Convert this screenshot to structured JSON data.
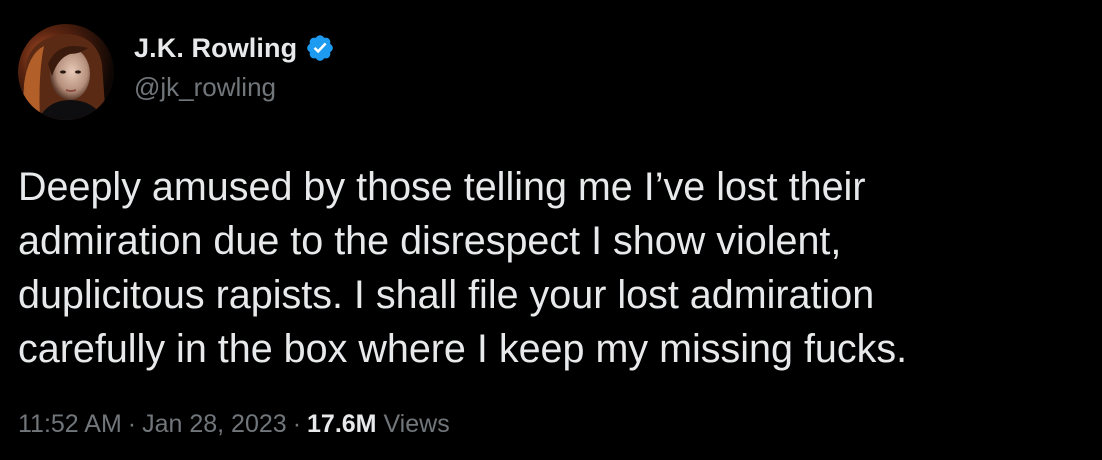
{
  "author": {
    "display_name": "J.K. Rowling",
    "handle": "@jk_rowling",
    "verified": true,
    "verified_color": "#1d9bf0"
  },
  "tweet": {
    "lines": [
      "Deeply amused by those telling me I’ve lost their",
      "admiration due to the disrespect I show violent,",
      "duplicitous rapists. I shall file your lost admiration",
      "carefully in the box where I keep my missing fucks."
    ]
  },
  "meta": {
    "time": "11:52 AM",
    "separator": "·",
    "date": "Jan 28, 2023",
    "views_count": "17.6M",
    "views_label": "Views"
  },
  "icons": {
    "verified": "verified-badge-icon",
    "avatar": "profile-photo"
  },
  "colors": {
    "background": "#000000",
    "primary_text": "#e7e9ea",
    "secondary_text": "#71767b"
  }
}
